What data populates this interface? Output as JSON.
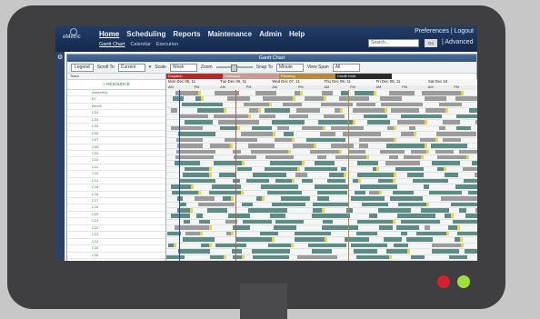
{
  "app": {
    "logo": "eMetric",
    "nav": [
      "Home",
      "Scheduling",
      "Reports",
      "Maintenance",
      "Admin",
      "Help"
    ],
    "subnav": [
      "Gantt Chart",
      "Calendar",
      "Execution"
    ],
    "util": "Preferences | Logout",
    "search_placeholder": "Search...",
    "go_label": "Go",
    "advanced": "| Advanced"
  },
  "panel": {
    "title": "Gantt Chart",
    "legend": "Legend",
    "scroll_to_label": "Scroll To",
    "scroll_to_value": "Current",
    "scale_label": "Scale",
    "scale_value": "Week",
    "zoom_label": "Zoom",
    "snap_label": "Snap To",
    "snap_value": "Minute",
    "view_span_label": "View Span",
    "view_span_value": "All"
  },
  "status_legend": [
    {
      "label": "Dispatch",
      "color": "#b42a2a"
    },
    {
      "label": "Released",
      "color": "#c99a8f"
    },
    {
      "label": "Planning",
      "color": "#b58a3a"
    },
    {
      "label": "Credit Hold",
      "color": "#2a2a2a"
    }
  ],
  "resources": {
    "header": "Team",
    "add_label": "+ RESOURCE",
    "items": [
      "Assembly",
      "B7",
      "Bench",
      "C02",
      "C04",
      "C05",
      "C06",
      "C07",
      "C08",
      "C09",
      "C10",
      "C11",
      "C12",
      "C14",
      "C15",
      "C16",
      "C17",
      "C19",
      "C20",
      "C21",
      "C22",
      "C23",
      "C24",
      "C25",
      "C26"
    ]
  },
  "timeline": {
    "days": [
      "Mon Dec 05, 11",
      "Tue Dec 06, 11",
      "Wed Dec 07, 11",
      "Thu Dec 08, 11",
      "Fri Dec 09, 11",
      "Sat Dec 10"
    ],
    "ampm": [
      "AM",
      "PM",
      "AM",
      "PM",
      "AM",
      "PM",
      "AM",
      "PM",
      "AM",
      "PM",
      "AM",
      "PM"
    ]
  },
  "colors": {
    "frame": "#3f3f41",
    "nav": "#213d6a",
    "bar_teal": "#5d8c86",
    "bar_gray": "#9b9b9b",
    "bar_yellow": "#e8d44a",
    "current": "#2a3fc0",
    "red_dot": "#d81f2c",
    "green_dot": "#9de03c"
  }
}
